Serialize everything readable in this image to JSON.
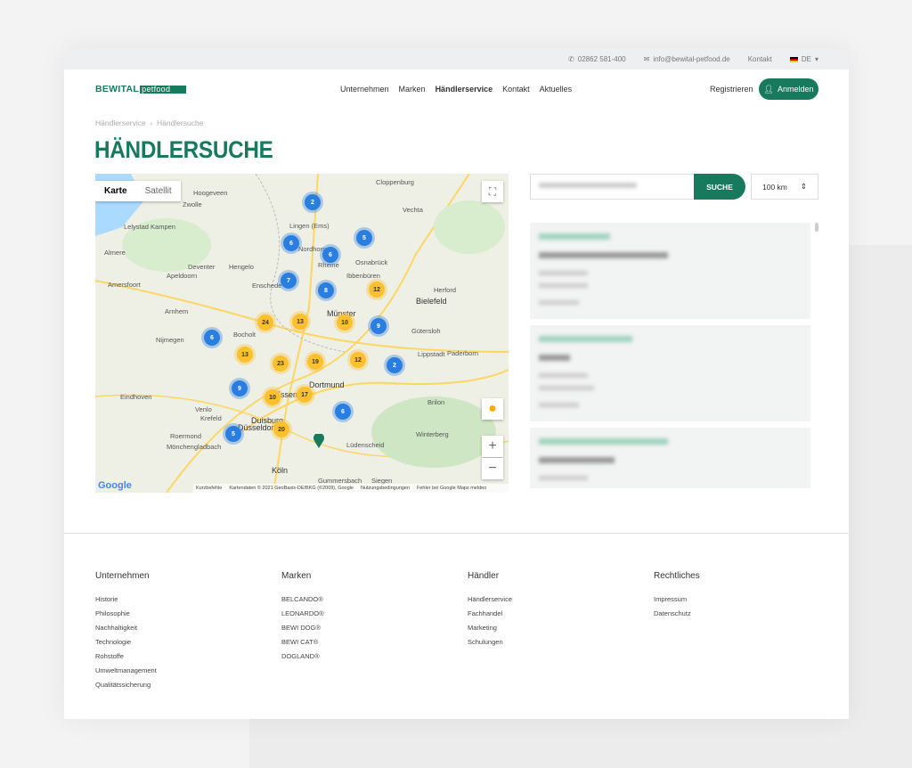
{
  "topbar": {
    "phone": "02862 581-400",
    "email": "info@bewital-petfood.de",
    "contact": "Kontakt",
    "lang": "DE"
  },
  "header": {
    "logo_main": "BEWITAL",
    "logo_sub": "petfood",
    "nav": [
      "Unternehmen",
      "Marken",
      "Händlerservice",
      "Kontakt",
      "Aktuelles"
    ],
    "register": "Registrieren",
    "login": "Anmelden"
  },
  "breadcrumb": [
    "Händlerservice",
    "Händlersuche"
  ],
  "title": "HÄNDLERSUCHE",
  "map": {
    "types": [
      "Karte",
      "Satellit"
    ],
    "logo": "Google",
    "attribution": [
      "Kurzbefehle",
      "Kartendaten © 2021 GeoBasis-DE/BKG (©2009), Google",
      "Nutzungsbedingungen",
      "Fehler bei Google Maps melden"
    ],
    "clusters": [
      {
        "n": "2",
        "c": "b"
      },
      {
        "n": "6",
        "c": "b"
      },
      {
        "n": "5",
        "c": "b"
      },
      {
        "n": "6",
        "c": "b"
      },
      {
        "n": "7",
        "c": "b"
      },
      {
        "n": "8",
        "c": "b"
      },
      {
        "n": "9",
        "c": "b"
      },
      {
        "n": "6",
        "c": "b"
      },
      {
        "n": "2",
        "c": "b"
      },
      {
        "n": "9",
        "c": "b"
      },
      {
        "n": "6",
        "c": "b"
      },
      {
        "n": "5",
        "c": "b"
      },
      {
        "n": "12",
        "c": "y"
      },
      {
        "n": "24",
        "c": "y"
      },
      {
        "n": "13",
        "c": "y"
      },
      {
        "n": "10",
        "c": "y"
      },
      {
        "n": "13",
        "c": "y"
      },
      {
        "n": "23",
        "c": "y"
      },
      {
        "n": "19",
        "c": "y"
      },
      {
        "n": "12",
        "c": "y"
      },
      {
        "n": "10",
        "c": "y"
      },
      {
        "n": "17",
        "c": "y"
      },
      {
        "n": "20",
        "c": "y"
      }
    ],
    "cities": [
      "Hoogeveen",
      "Zwolle",
      "Lelystad Kampen",
      "Almere",
      "Apeldoorn",
      "Deventer",
      "Amersfoort",
      "Arnhem",
      "Nijmegen",
      "Eindhoven",
      "Venlo",
      "Roermond",
      "Mönchengladbach",
      "Krefeld",
      "Duisburg",
      "Essen",
      "Düsseldorf",
      "Köln",
      "Dortmund",
      "Münster",
      "Bielefeld",
      "Osnabrück",
      "Enschede",
      "Hengelo",
      "Bocholt",
      "Lingen (Ems)",
      "Rheine",
      "Ibbenbüren",
      "Herford",
      "Gütersloh",
      "Paderborn",
      "Lippstadt",
      "Lüdenscheid",
      "Gummersbach",
      "Siegen",
      "Vechta",
      "Nordhorn",
      "Brilon",
      "Winterberg",
      "Cloppenburg"
    ]
  },
  "search": {
    "button": "SUCHE",
    "radius": "100 km"
  },
  "footer": {
    "columns": [
      {
        "title": "Unternehmen",
        "links": [
          "Historie",
          "Philosophie",
          "Nachhaltigkeit",
          "Technologie",
          "Rohstoffe",
          "Umweltmanagement",
          "Qualitätssicherung"
        ]
      },
      {
        "title": "Marken",
        "links": [
          "BELCANDO®",
          "LEONARDO®",
          "BEWI DOG®",
          "BEWI CAT®",
          "DOGLAND®"
        ]
      },
      {
        "title": "Händler",
        "links": [
          "Händlerservice",
          "Fachhandel",
          "Marketing",
          "Schulungen"
        ]
      },
      {
        "title": "Rechtliches",
        "links": [
          "Impressum",
          "Datenschutz"
        ]
      }
    ]
  }
}
